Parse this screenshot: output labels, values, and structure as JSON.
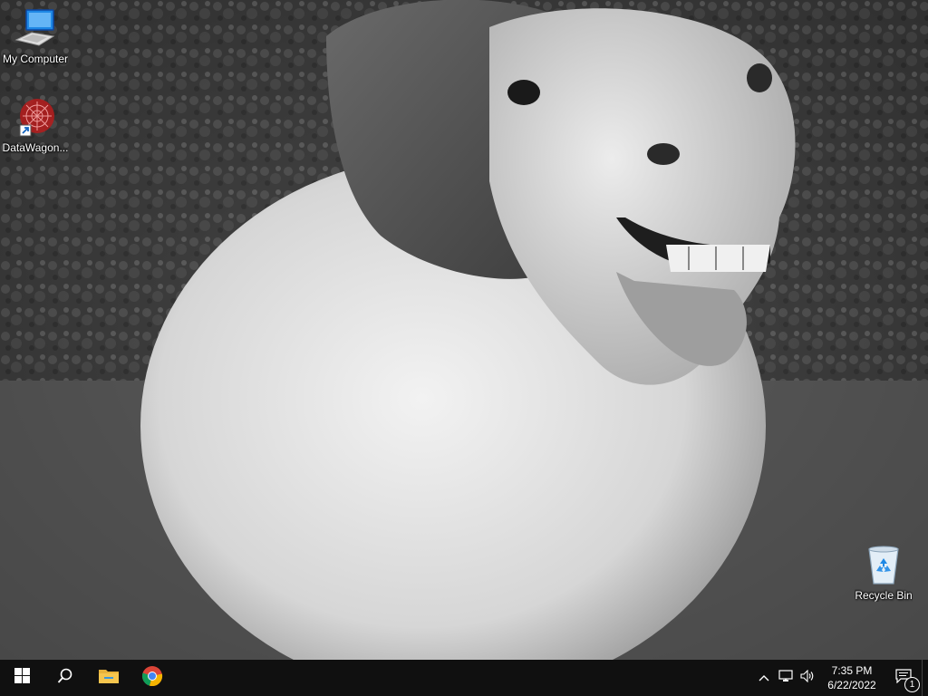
{
  "desktop": {
    "icons": [
      {
        "label": "My Computer",
        "icon": "computer-icon"
      },
      {
        "label": "DataWagon...",
        "icon": "datawagon-app-icon"
      },
      {
        "label": "Recycle Bin",
        "icon": "recycle-bin-icon"
      }
    ]
  },
  "taskbar": {
    "pinned": [
      {
        "name": "Start",
        "icon": "windows-logo-icon"
      },
      {
        "name": "Search",
        "icon": "search-icon"
      },
      {
        "name": "File Explorer",
        "icon": "folder-icon"
      },
      {
        "name": "Google Chrome",
        "icon": "chrome-icon"
      }
    ],
    "tray": {
      "icons": [
        "chevron-up-icon",
        "network-icon",
        "volume-icon"
      ],
      "time": "7:35 PM",
      "date": "6/22/2022",
      "notification_count": "1"
    }
  },
  "colors": {
    "taskbar": "#101010",
    "accent_blue": "#3a96dd",
    "folder_yellow": "#e8b23a"
  }
}
